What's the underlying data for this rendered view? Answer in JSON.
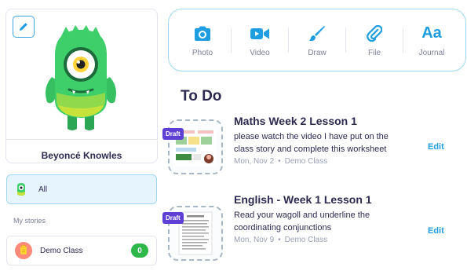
{
  "colors": {
    "accent": "#1e9ee0",
    "draft_badge": "#5d3fd3",
    "count_badge": "#2eb84a",
    "selected_bg": "#e6f5fd",
    "monster": "#3fcf6a"
  },
  "profile": {
    "name": "Beyoncé Knowles",
    "avatar_icon": "green-monster-avatar",
    "edit_icon": "pencil-icon"
  },
  "sidebar": {
    "all_label": "All",
    "section_label": "My stories",
    "classes": [
      {
        "label": "Demo Class",
        "count": "0",
        "icon": "class-avatar-icon"
      }
    ]
  },
  "toolbar": {
    "items": [
      {
        "label": "Photo",
        "icon": "camera-icon"
      },
      {
        "label": "Video",
        "icon": "video-camera-icon"
      },
      {
        "label": "Draw",
        "icon": "paintbrush-icon"
      },
      {
        "label": "File",
        "icon": "paperclip-icon"
      },
      {
        "label": "Journal",
        "icon": "Aa",
        "icon_name": "journal-icon"
      }
    ]
  },
  "todo": {
    "title": "To Do",
    "tasks": [
      {
        "badge": "Draft",
        "title": "Maths Week 2 Lesson 1",
        "description": "please watch the video I have put on the class story and complete this worksheet",
        "date": "Mon, Nov 2",
        "class": "Demo Class",
        "action": "Edit"
      },
      {
        "badge": "Draft",
        "title": "English - Week 1 Lesson 1",
        "description": "Read your wagoll and underline the coordinating conjunctions",
        "date": "Mon, Nov 9",
        "class": "Demo Class",
        "action": "Edit"
      }
    ]
  }
}
